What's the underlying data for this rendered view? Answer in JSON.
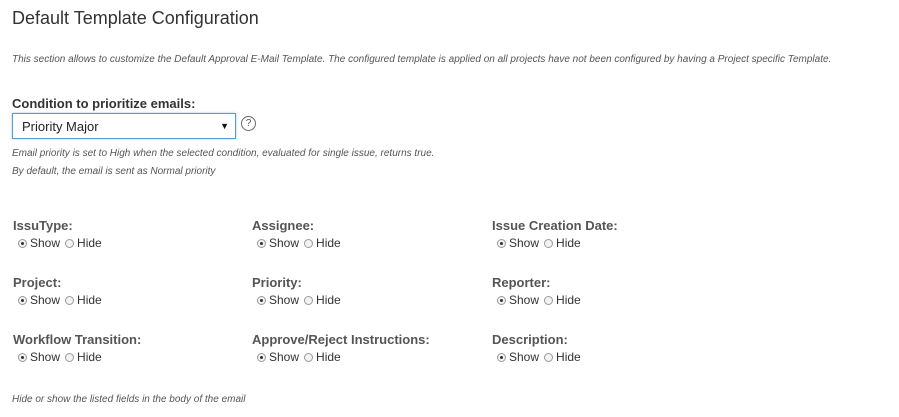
{
  "page": {
    "title": "Default Template Configuration",
    "description": "This section allows to customize the Default Approval E-Mail Template. The configured template is applied on all projects have not been configured by having a Project specific Template."
  },
  "condition": {
    "label": "Condition to prioritize emails:",
    "selected": "Priority Major",
    "help_symbol": "?",
    "note_line1": "Email priority is set to High when the selected condition, evaluated for single issue, returns true.",
    "note_line2": "By default, the email is sent as Normal priority"
  },
  "options": {
    "show": "Show",
    "hide": "Hide"
  },
  "fields": [
    {
      "label": "IssuType:",
      "selected": "show"
    },
    {
      "label": "Assignee:",
      "selected": "show"
    },
    {
      "label": "Issue Creation Date:",
      "selected": "show"
    },
    {
      "label": "Project:",
      "selected": "show"
    },
    {
      "label": "Priority:",
      "selected": "show"
    },
    {
      "label": "Reporter:",
      "selected": "show"
    },
    {
      "label": "Workflow Transition:",
      "selected": "show"
    },
    {
      "label": "Approve/Reject Instructions:",
      "selected": "show"
    },
    {
      "label": "Description:",
      "selected": "show"
    }
  ],
  "footer": {
    "note": "Hide or show the listed fields in the body of the email"
  },
  "icons": {
    "dropdown": "caret-down-icon",
    "help": "help-circle-icon"
  }
}
